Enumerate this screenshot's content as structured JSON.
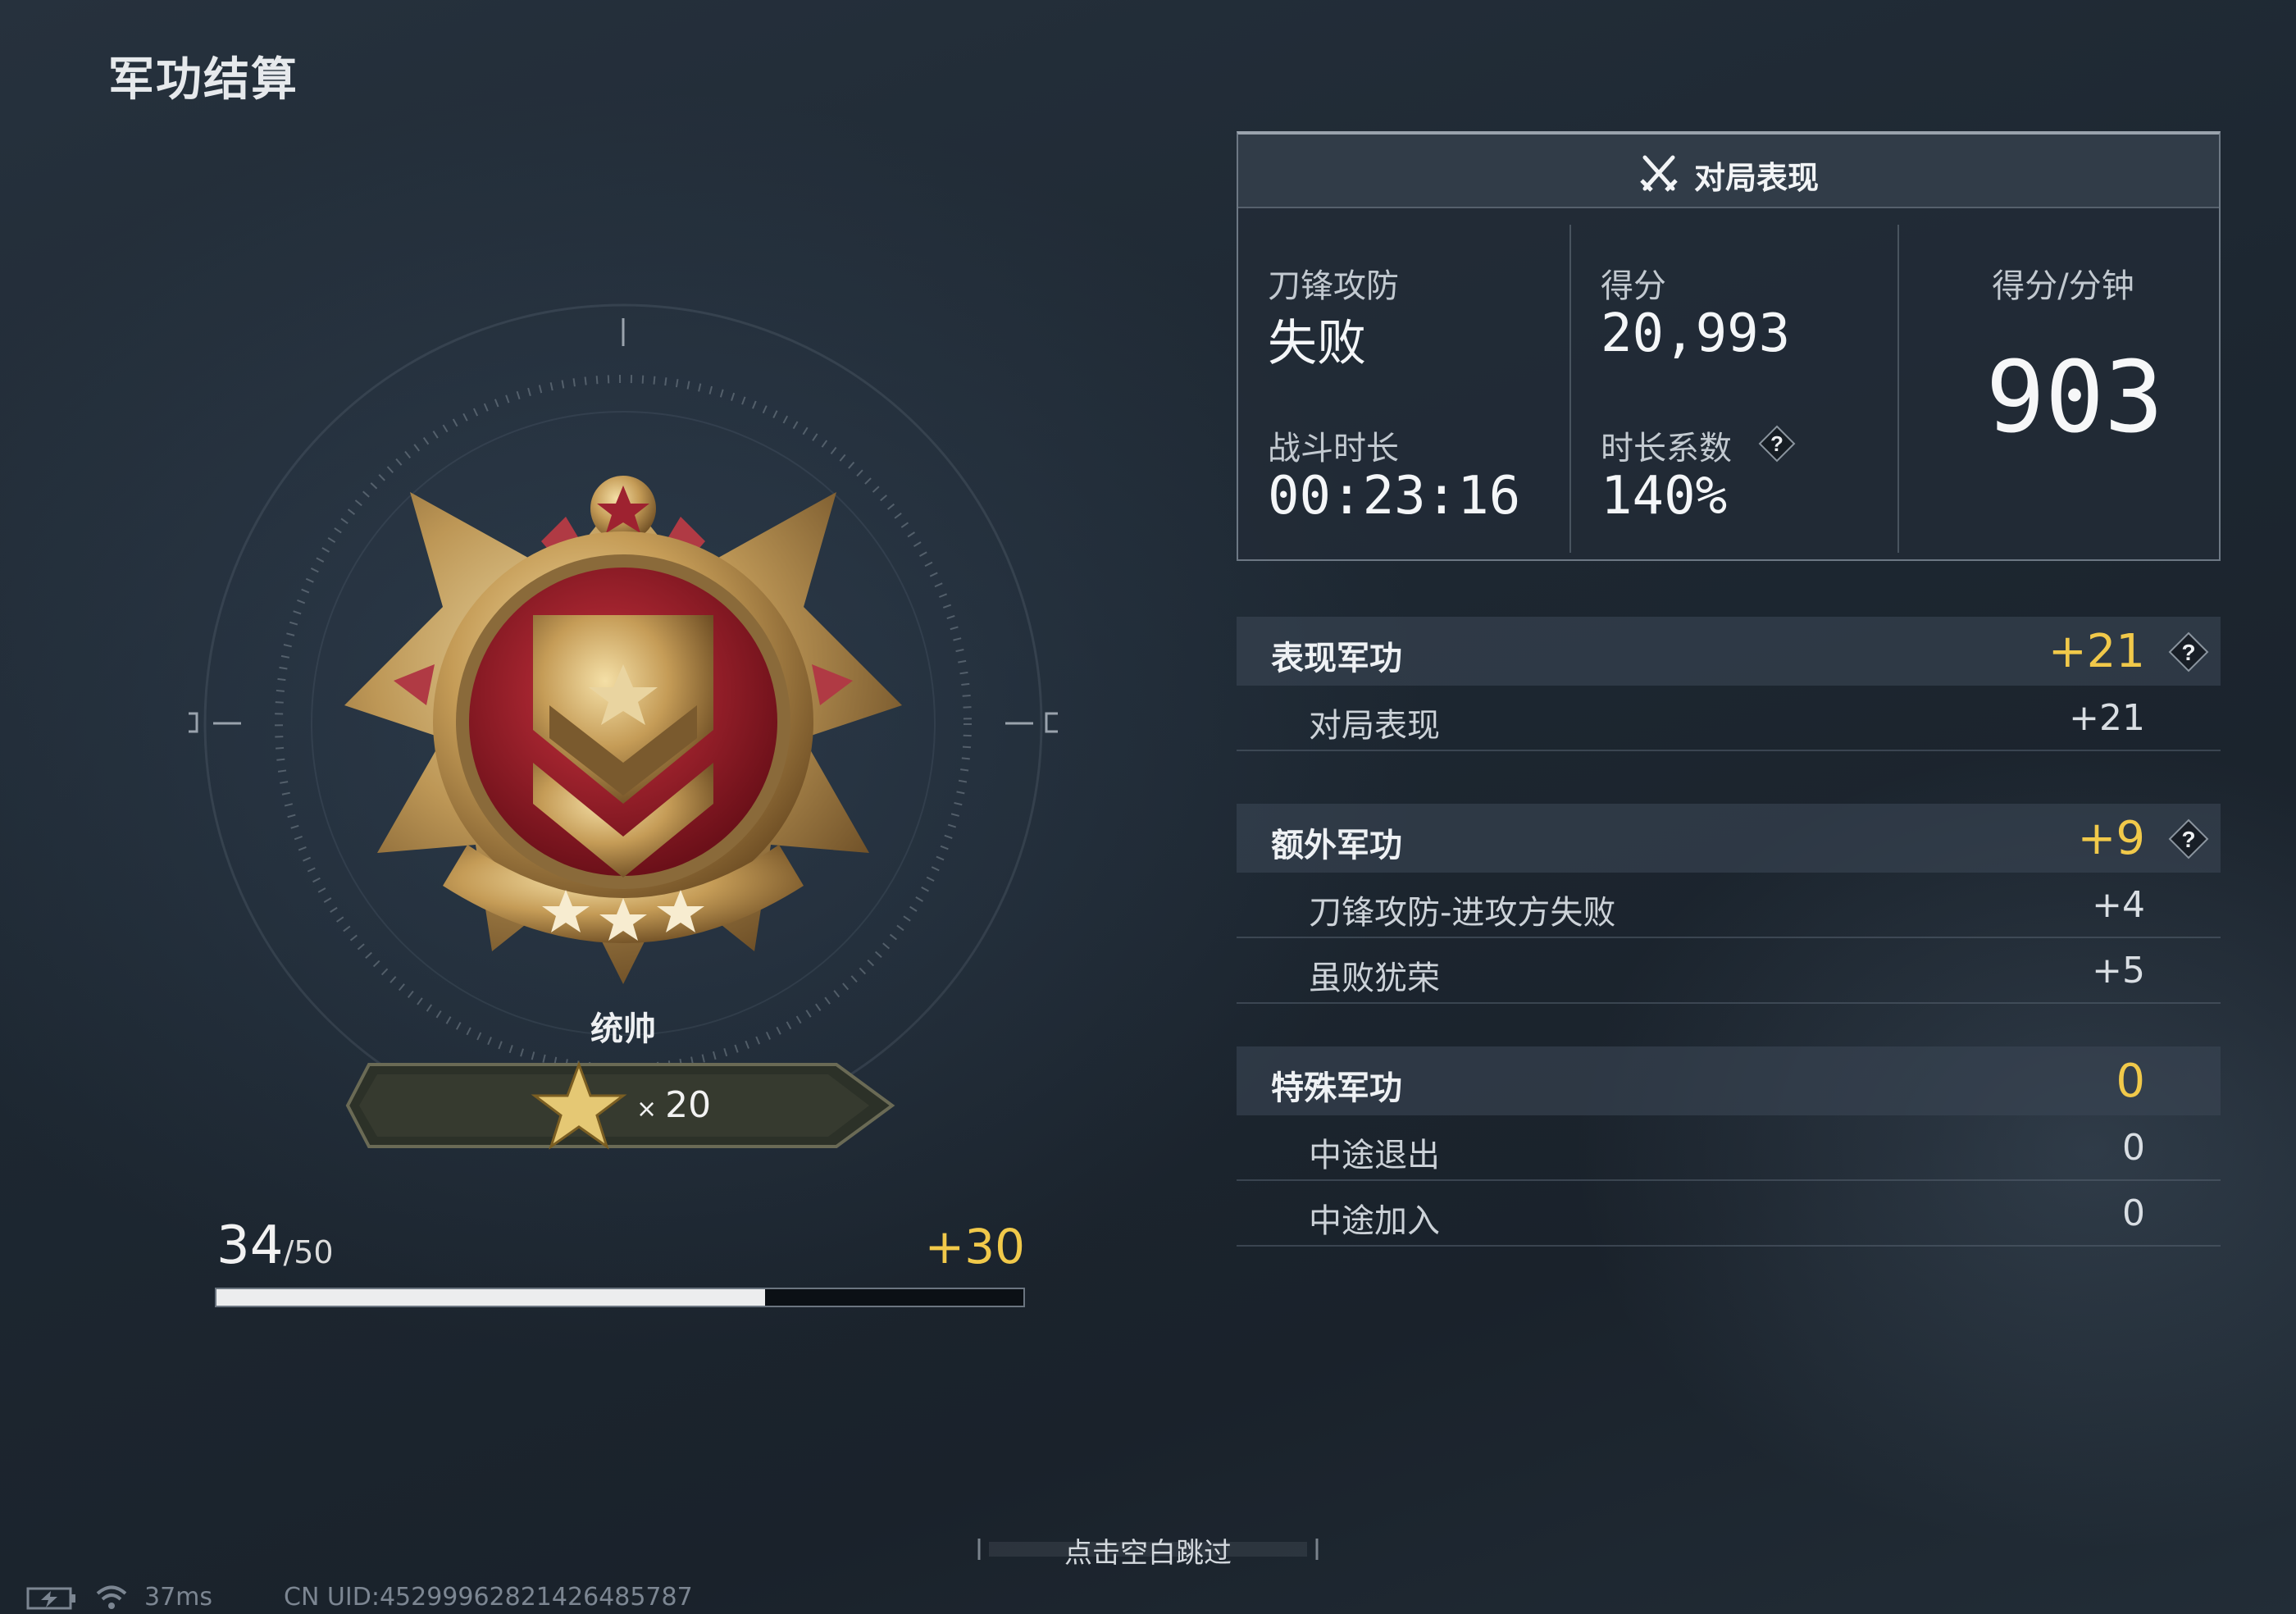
{
  "page": {
    "title": "军功结算"
  },
  "rank": {
    "name": "统帅",
    "star_multiplier": "×",
    "star_count": "20",
    "progress_current": "34",
    "progress_max": "/50",
    "progress_value": 0.68,
    "progress_gain": "+30"
  },
  "match_performance": {
    "title": "对局表现",
    "mode_label": "刀锋攻防",
    "mode_result": "失败",
    "score_label": "得分",
    "score_value": "20,993",
    "per_minute_label": "得分/分钟",
    "per_minute_value": "903",
    "duration_label": "战斗时长",
    "duration_value": "00:23:16",
    "coefficient_label": "时长系数",
    "coefficient_value": "140%",
    "help_glyph": "?"
  },
  "merit_sections": [
    {
      "title": "表现军功",
      "value": "+21",
      "has_help": true,
      "rows": [
        {
          "label": "对局表现",
          "value": "+21"
        }
      ]
    },
    {
      "title": "额外军功",
      "value": "+9",
      "has_help": true,
      "rows": [
        {
          "label": "刀锋攻防-进攻方失败",
          "value": "+4"
        },
        {
          "label": "虽败犹荣",
          "value": "+5"
        }
      ]
    },
    {
      "title": "特殊军功",
      "value": "0",
      "has_help": false,
      "rows": [
        {
          "label": "中途退出",
          "value": "0"
        },
        {
          "label": "中途加入",
          "value": "0"
        }
      ]
    }
  ],
  "footer": {
    "skip_hint": "点击空白跳过",
    "ping": "37ms",
    "uid": "CN UID:452999628214264857​87"
  },
  "colors": {
    "accent_gold": "#f1c94a",
    "panel_bg": "#222c37",
    "emblem_red": "#a3202c"
  },
  "icons": [
    "crossed-swords-icon",
    "question-icon",
    "battery-icon",
    "wifi-icon",
    "gold-star-icon"
  ]
}
